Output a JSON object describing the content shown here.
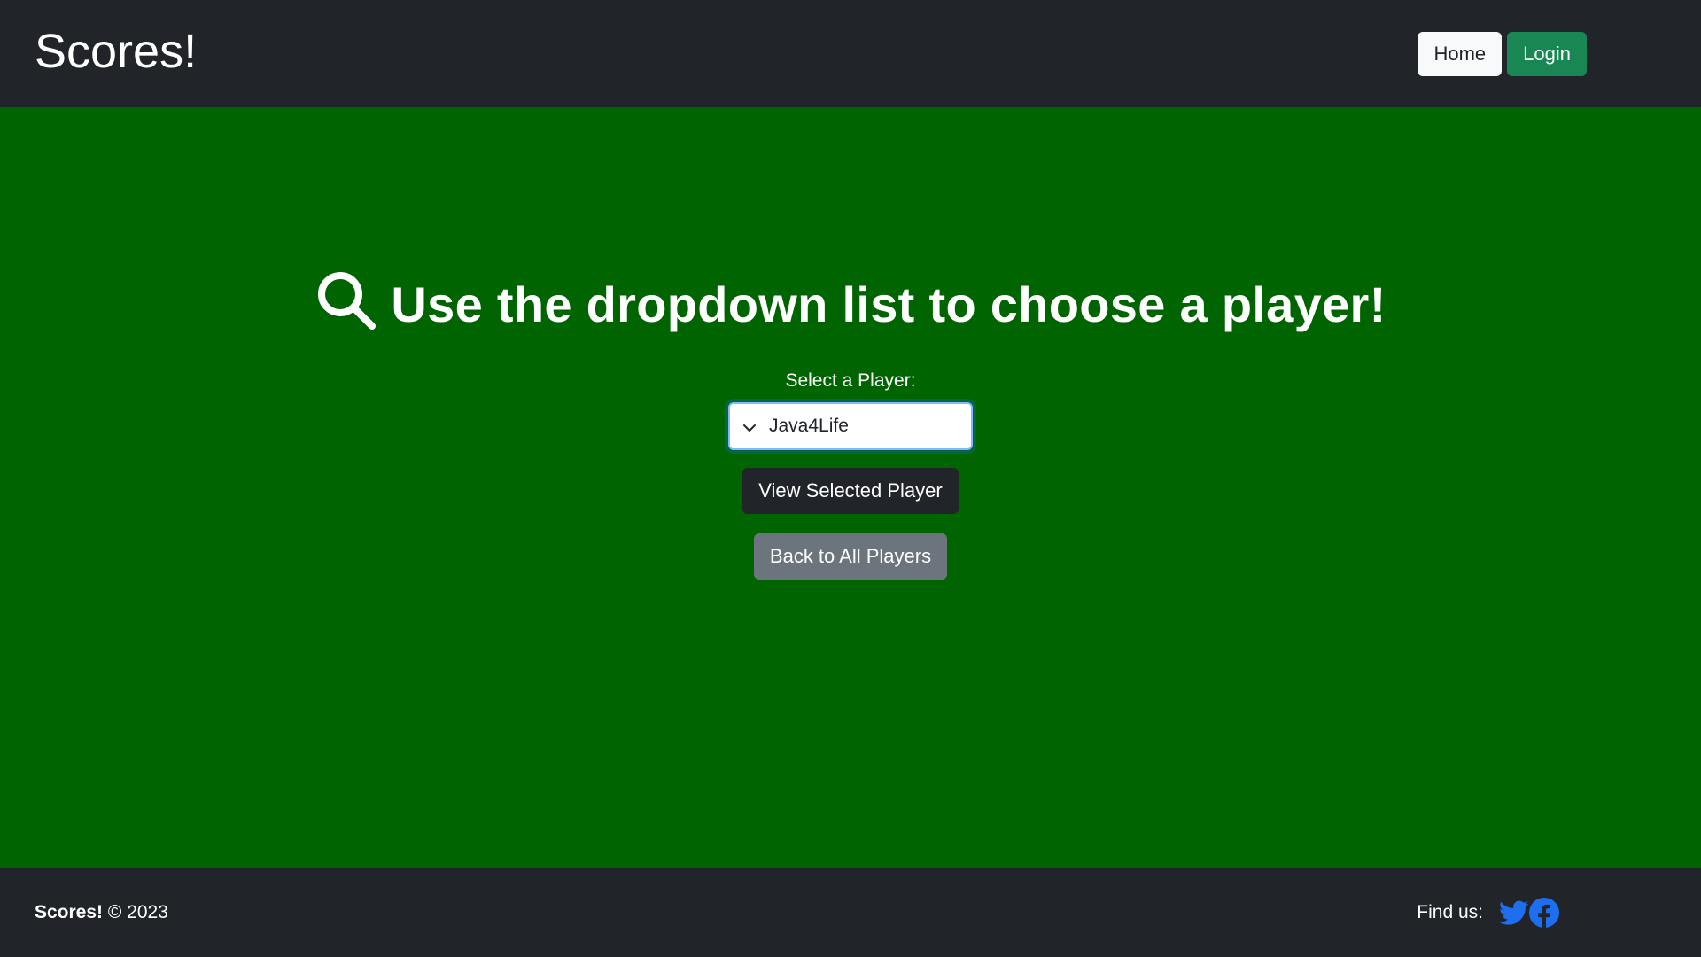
{
  "header": {
    "brand": "Scores!",
    "nav": {
      "home": "Home",
      "login": "Login"
    }
  },
  "main": {
    "headline": "Use the dropdown list to choose a player!",
    "select_label": "Select a Player:",
    "selected_player": "Java4Life",
    "view_button": "View Selected Player",
    "back_button": "Back to All Players"
  },
  "footer": {
    "brand": "Scores!",
    "copyright": "© 2023",
    "find_us": "Find us:",
    "social_icons": [
      "twitter-icon",
      "facebook-icon"
    ]
  },
  "colors": {
    "header_bg": "#212529",
    "main_bg": "#006400",
    "login_green": "#198754",
    "social_blue": "#1d6ef0"
  }
}
